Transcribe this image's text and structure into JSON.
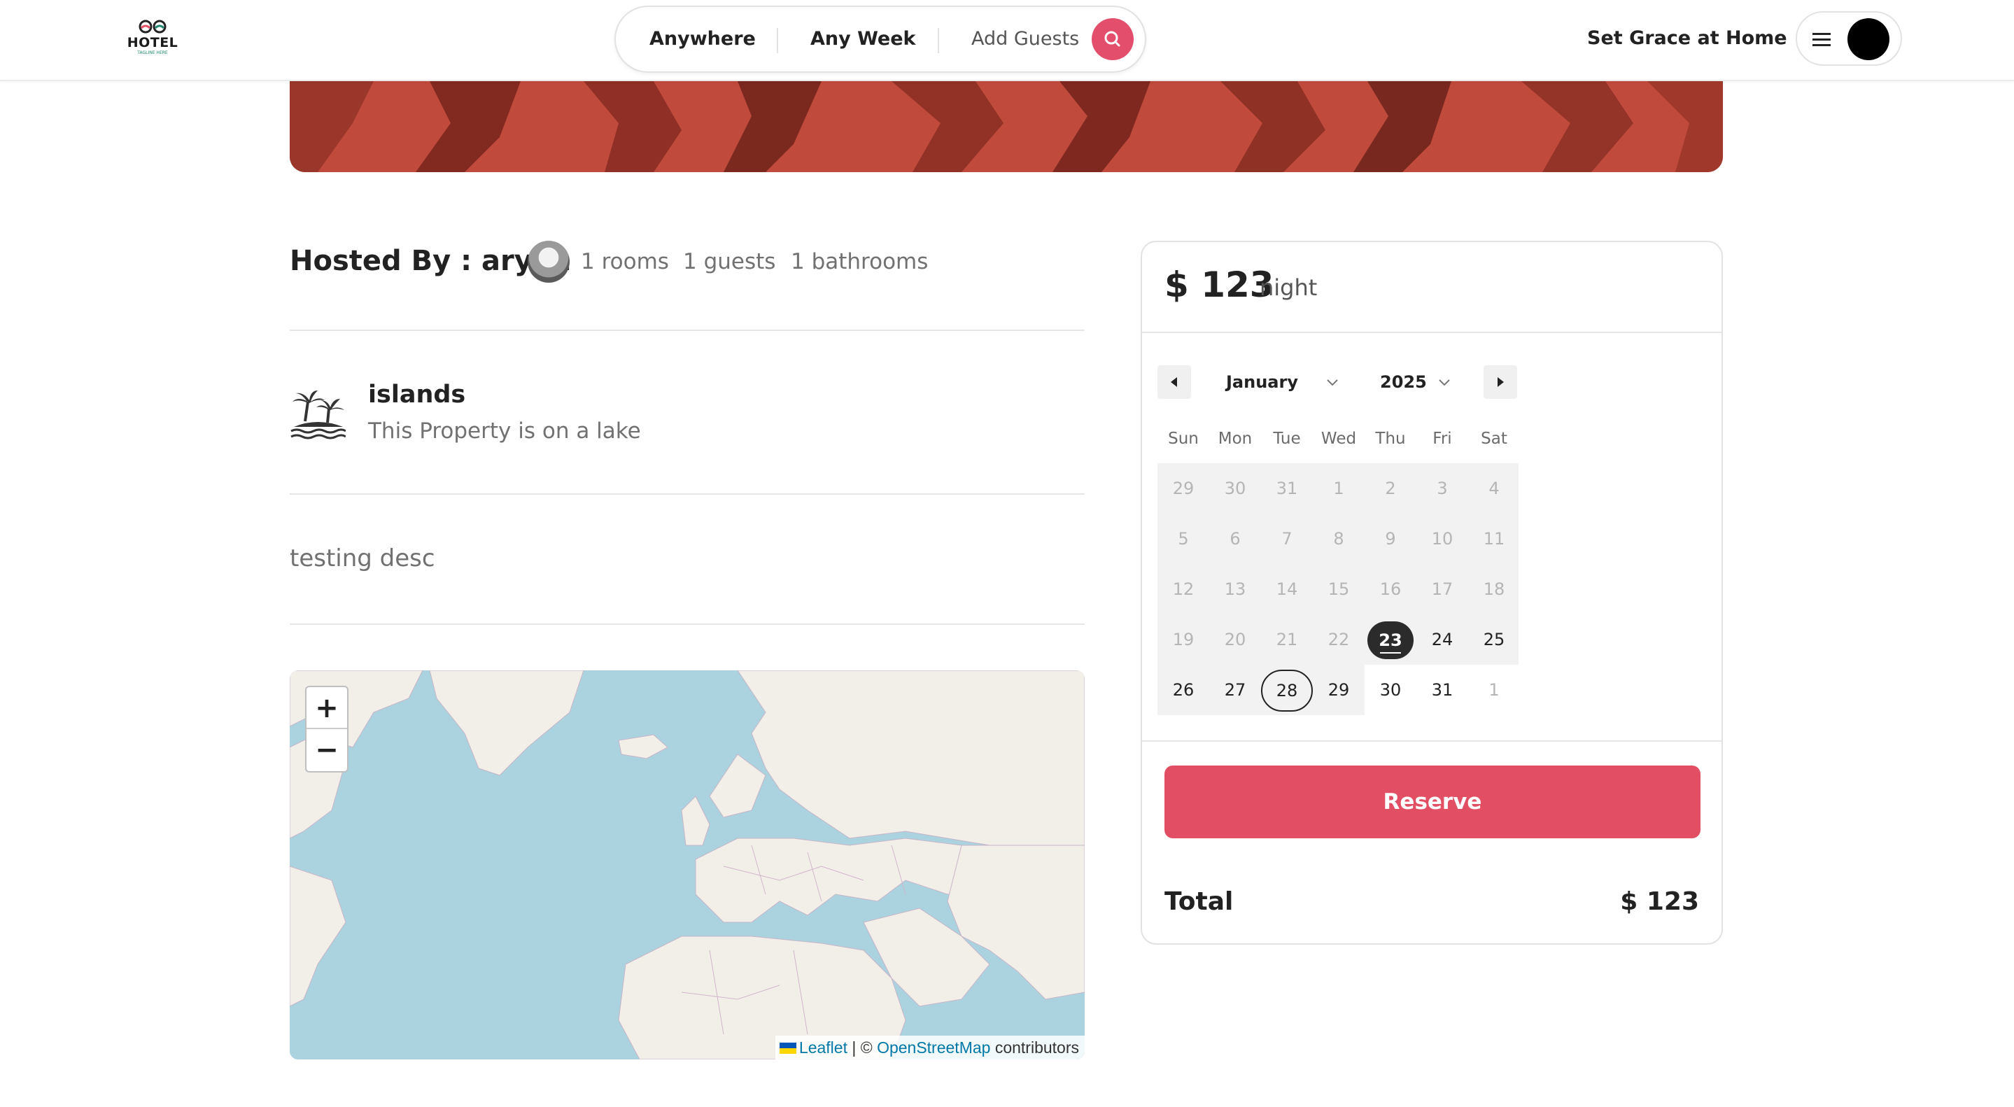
{
  "header": {
    "logo_text": "HOTEL",
    "logo_subtext": "TAGLINE HERE",
    "search": {
      "where": "Anywhere",
      "when": "Any Week",
      "who": "Add Guests"
    },
    "host_link": "Set Grace at Home"
  },
  "listing": {
    "hosted_by": "Hosted By : aryan",
    "rooms": "1 rooms",
    "guests": "1 guests",
    "bathrooms": "1 bathrooms",
    "category": {
      "name": "islands",
      "description": "This Property is on a lake",
      "icon": "island-icon"
    },
    "description": "testing desc"
  },
  "map": {
    "zoom_in": "+",
    "zoom_out": "−",
    "attribution_leaflet": "Leaflet",
    "attribution_sep": " | © ",
    "attribution_osm": "OpenStreetMap",
    "attribution_suffix": " contributors"
  },
  "booking": {
    "price": "$ 123",
    "per": "night",
    "calendar": {
      "month": "January",
      "year": "2025",
      "weekdays": [
        "Sun",
        "Mon",
        "Tue",
        "Wed",
        "Thu",
        "Fri",
        "Sat"
      ],
      "weeks": [
        [
          "29",
          "30",
          "31",
          "1",
          "2",
          "3",
          "4"
        ],
        [
          "5",
          "6",
          "7",
          "8",
          "9",
          "10",
          "11"
        ],
        [
          "12",
          "13",
          "14",
          "15",
          "16",
          "17",
          "18"
        ],
        [
          "19",
          "20",
          "21",
          "22",
          "23",
          "24",
          "25"
        ],
        [
          "26",
          "27",
          "28",
          "29",
          "30",
          "31",
          "1"
        ]
      ],
      "today": "23",
      "selected": "28"
    },
    "reserve_label": "Reserve",
    "total_label": "Total",
    "total_value": "$ 123"
  },
  "colors": {
    "brand": "#e24e63",
    "text": "#222222",
    "muted": "#717171"
  }
}
